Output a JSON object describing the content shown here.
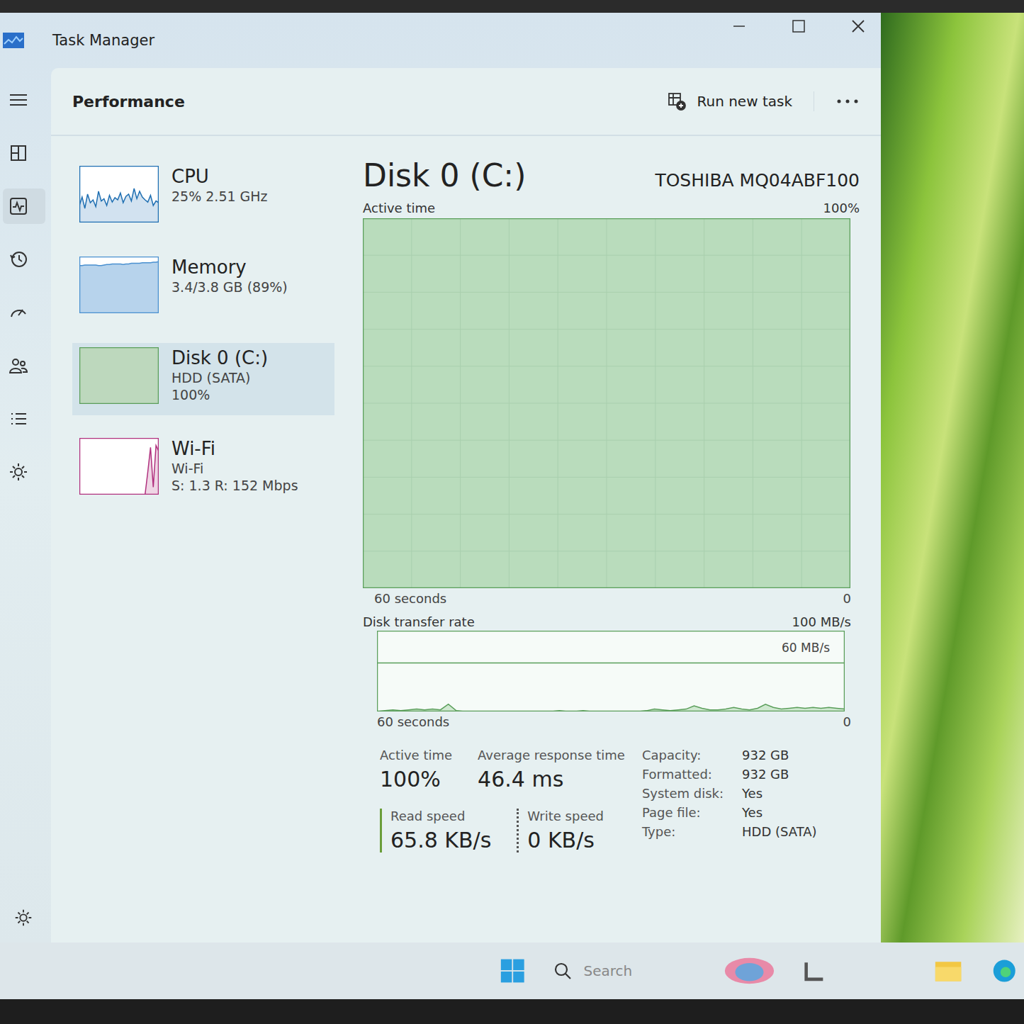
{
  "window": {
    "title": "Task Manager"
  },
  "header": {
    "title": "Performance",
    "run_task": "Run new task"
  },
  "nav": [
    {
      "selected": false
    },
    {
      "selected": false
    },
    {
      "selected": true
    },
    {
      "selected": false
    },
    {
      "selected": false
    },
    {
      "selected": false
    },
    {
      "selected": false
    },
    {
      "selected": false
    }
  ],
  "resources": [
    {
      "name": "CPU",
      "lines": [
        "25% 2.51 GHz"
      ],
      "selected": false,
      "kind": "line",
      "color": "#1f6fb2",
      "max": 100,
      "values": [
        30,
        45,
        25,
        50,
        35,
        40,
        28,
        55,
        38,
        42,
        30,
        48,
        36,
        44,
        40,
        52,
        35,
        46,
        50,
        38,
        60,
        42,
        55,
        45,
        40,
        36,
        48,
        30,
        38,
        35
      ]
    },
    {
      "name": "Memory",
      "lines": [
        "3.4/3.8 GB (89%)"
      ],
      "selected": false,
      "kind": "area",
      "color": "#4a90d0",
      "max": 100,
      "values": [
        84,
        84,
        85,
        85,
        85,
        85,
        85,
        84,
        84,
        85,
        86,
        86,
        87,
        87,
        87,
        87,
        86,
        87,
        87,
        88,
        88,
        88,
        88,
        89,
        89,
        89,
        89,
        90,
        90,
        91
      ]
    },
    {
      "name": "Disk 0 (C:)",
      "lines": [
        "HDD (SATA)",
        "100%"
      ],
      "selected": true,
      "kind": "area",
      "color": "#5a9e5a",
      "max": 100,
      "values": [
        100,
        100,
        100,
        100,
        100,
        100,
        100,
        100,
        100,
        100,
        100,
        100,
        100,
        100,
        100,
        100,
        100,
        100,
        100,
        100,
        100,
        100,
        100,
        100,
        100,
        100,
        100,
        100,
        100,
        100
      ]
    },
    {
      "name": "Wi-Fi",
      "lines": [
        "Wi-Fi",
        "S: 1.3 R: 152 Mbps"
      ],
      "selected": false,
      "kind": "line",
      "color": "#b0307e",
      "max": 300,
      "values": [
        0,
        0,
        0,
        0,
        0,
        0,
        0,
        0,
        0,
        0,
        0,
        0,
        0,
        0,
        0,
        0,
        0,
        0,
        0,
        0,
        0,
        0,
        0,
        0,
        0,
        120,
        250,
        40,
        260,
        230
      ]
    }
  ],
  "detail": {
    "title": "Disk 0 (C:)",
    "model": "TOSHIBA MQ04ABF100",
    "active_chart": {
      "label": "Active time",
      "max_label": "100%",
      "time_label": "60 seconds",
      "min_label": "0",
      "max": 100,
      "values": [
        100,
        100,
        100,
        100,
        100,
        100,
        100,
        100,
        100,
        100,
        100,
        100,
        100,
        100,
        100,
        100,
        100,
        100,
        100,
        100,
        100,
        100,
        100,
        100,
        100,
        100,
        100,
        100,
        100,
        100,
        100,
        100,
        100,
        100,
        100,
        100,
        100,
        100,
        100,
        100,
        100,
        100,
        100,
        100,
        100,
        100,
        100,
        100,
        100,
        100,
        100,
        100,
        100,
        100,
        100,
        100,
        100,
        100,
        100,
        100
      ]
    },
    "transfer_chart": {
      "label": "Disk transfer rate",
      "max_label": "100 MB/s",
      "line_label": "60 MB/s",
      "line_value": 60,
      "time_label": "60 seconds",
      "min_label": "0",
      "max": 100,
      "values": [
        0,
        1,
        2,
        1,
        2,
        3,
        2,
        3,
        2,
        9,
        1,
        0,
        0,
        0,
        0,
        0,
        0,
        0,
        0,
        0,
        0,
        0,
        0,
        1,
        0,
        0,
        1,
        0,
        0,
        0,
        0,
        0,
        0,
        0,
        1,
        3,
        2,
        1,
        2,
        3,
        7,
        4,
        2,
        2,
        3,
        5,
        3,
        2,
        4,
        9,
        5,
        3,
        4,
        5,
        4,
        5,
        4,
        5,
        4,
        3
      ]
    },
    "stats": [
      {
        "label": "Active time",
        "value": "100%"
      },
      {
        "label": "Average response time",
        "value": "46.4 ms"
      }
    ],
    "speeds": [
      {
        "label": "Read speed",
        "value": "65.8 KB/s",
        "kind": "solid"
      },
      {
        "label": "Write speed",
        "value": "0 KB/s",
        "kind": "dotted"
      }
    ],
    "properties": [
      {
        "label": "Capacity:",
        "value": "932 GB"
      },
      {
        "label": "Formatted:",
        "value": "932 GB"
      },
      {
        "label": "System disk:",
        "value": "Yes"
      },
      {
        "label": "Page file:",
        "value": "Yes"
      },
      {
        "label": "Type:",
        "value": "HDD (SATA)"
      }
    ]
  },
  "taskbar": {
    "search_placeholder": "Search"
  }
}
